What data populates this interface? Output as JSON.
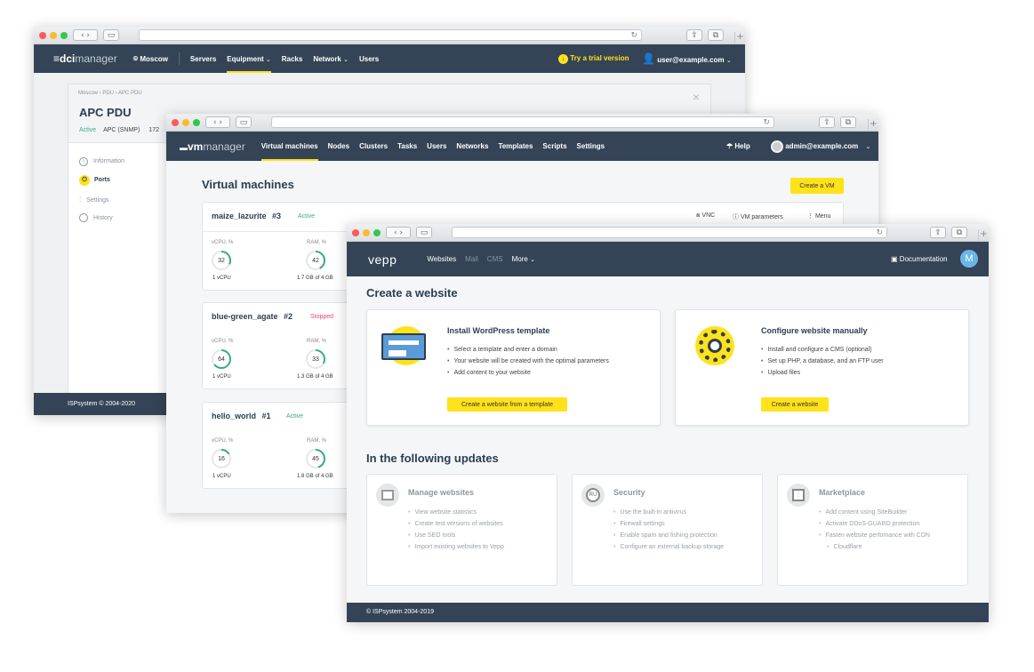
{
  "dci": {
    "logo_a": "≡dci",
    "logo_b": "manager",
    "location": "Moscow",
    "nav": [
      "Servers",
      "Equipment",
      "Racks",
      "Network",
      "Users"
    ],
    "trial": "Try a trial version",
    "user": "user@example.com",
    "breadcrumb": [
      "Moscow",
      "PDU",
      "APC PDU"
    ],
    "title": "APC PDU",
    "status": "Active",
    "model": "APC (SNMP)",
    "ip_fragment": "172",
    "sidebar": [
      "Information",
      "Ports",
      "Settings",
      "History"
    ],
    "footer": "ISPsystem © 2004-2020"
  },
  "vm": {
    "logo_a": "vm",
    "logo_b": "manager",
    "nav": [
      "Virtual machines",
      "Nodes",
      "Clusters",
      "Tasks",
      "Users",
      "Networks",
      "Templates",
      "Scripts",
      "Settings"
    ],
    "help": "Help",
    "user": "admin@example.com",
    "title": "Virtual machines",
    "create": "Create a VM",
    "actions": {
      "vnc": "VNC",
      "params": "VM parameters",
      "menu": "Menu"
    },
    "cpu_label": "vCPU, %",
    "ram_label": "RAM, %",
    "machines": [
      {
        "name": "maize_lazurite",
        "num": "#3",
        "status": "Active",
        "cpu": 32,
        "ram": 42,
        "cpu_sub": "1 vCPU",
        "ram_sub": "1.7 GB of 4 GB"
      },
      {
        "name": "blue-green_agate",
        "num": "#2",
        "status": "Stopped",
        "cpu": 64,
        "ram": 33,
        "cpu_sub": "1 vCPU",
        "ram_sub": "1.3 GB of 4 GB"
      },
      {
        "name": "hello_world",
        "num": "#1",
        "status": "Active",
        "cpu": 16,
        "ram": 45,
        "cpu_sub": "1 vCPU",
        "ram_sub": "1.8 GB of 4 GB"
      }
    ]
  },
  "vepp": {
    "logo": "vepp",
    "nav": [
      "Websites",
      "Mail",
      "CMS",
      "More"
    ],
    "doc": "Documentation",
    "avatar": "M",
    "title": "Create a website",
    "card1": {
      "title": "Install WordPress template",
      "items": [
        "Select a template and enter a domain",
        "Your website will be created with the optimal parameters",
        "Add content to your website"
      ],
      "button": "Create a website from a template"
    },
    "card2": {
      "title": "Configure website manually",
      "items": [
        "Install and configure a CMS (optional)",
        "Set up PHP, a database, and an FTP user",
        "Upload files"
      ],
      "button": "Create a website"
    },
    "updates_title": "In the following updates",
    "u1": {
      "title": "Manage websites",
      "items": [
        "View website statistics",
        "Create test versions of websites",
        "Use SEO tools",
        "Import existing websites to Vepp"
      ]
    },
    "u2": {
      "title": "Security",
      "badge": "RU",
      "items": [
        "Use the built-in antivirus",
        "Firewall settings",
        "Enable spam and fishing protection",
        "Configure an external backup storage"
      ]
    },
    "u3": {
      "title": "Marketplace",
      "items": [
        "Add content using SiteBuilder",
        "Activate DDoS-GUARD protection",
        "Fasten website perfomance with CDN",
        "Cloudflare"
      ]
    },
    "footer": "© ISPsystem 2004-2019"
  },
  "colors": {
    "nav": "#344456",
    "yellow": "#ffe21a",
    "active": "#3aaa8c",
    "stopped": "#e0457b"
  }
}
